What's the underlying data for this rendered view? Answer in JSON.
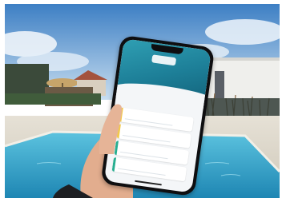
{
  "scene": {
    "description_colors": {
      "sky_top": "#3f86c9",
      "sky_bottom": "#bcd8ef",
      "pool_water": "#2fa4c8",
      "pool_deck": "#d9d4c8",
      "hedge": "#3c5f3a",
      "building": "#e9e9e6",
      "skin": "#e8b79a"
    }
  },
  "phone_app": {
    "logo_text": "",
    "greeting": "",
    "subtitle": "",
    "section_title": "",
    "section_subtitle": "",
    "cards": [
      {
        "label": "",
        "value": "",
        "accent": "#f2c94c"
      },
      {
        "label": "",
        "value": "",
        "accent": "#f2c94c"
      },
      {
        "label": "",
        "value": "",
        "accent": "#27ae90"
      },
      {
        "label": "",
        "value": "",
        "accent": "#27ae90"
      }
    ]
  }
}
